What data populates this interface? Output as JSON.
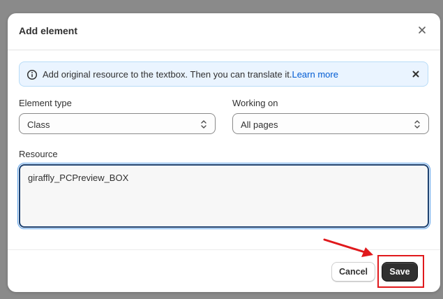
{
  "dialog": {
    "title": "Add element",
    "close_icon": "close-icon"
  },
  "banner": {
    "text": "Add original resource to the textbox. Then you can translate it.",
    "link": "Learn more",
    "info_icon": "info-circle-icon",
    "close_icon": "close-icon"
  },
  "form": {
    "element_type": {
      "label": "Element type",
      "value": "Class"
    },
    "working_on": {
      "label": "Working on",
      "value": "All pages"
    },
    "resource": {
      "label": "Resource",
      "value": "giraffly_PCPreview_BOX"
    }
  },
  "footer": {
    "cancel_label": "Cancel",
    "save_label": "Save"
  },
  "annotation": {
    "arrow_color": "#e0191c",
    "highlight_color": "#e0191c"
  }
}
